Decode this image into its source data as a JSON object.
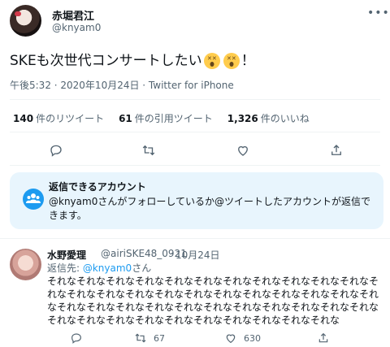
{
  "tweet": {
    "author_name": "赤堀君江",
    "author_handle": "@knyam0",
    "text": "SKEも次世代コンサートしたい",
    "text_suffix": "！",
    "emoji_icon": "astonished-face-icon",
    "meta": "午後5:32 · 2020年10月24日 · Twitter for iPhone",
    "more_icon": "more-icon",
    "stats": {
      "retweets_count": "140",
      "retweets_label": "件のリツイート",
      "quotes_count": "61",
      "quotes_label": "件の引用ツイート",
      "likes_count": "1,326",
      "likes_label": "件のいいね"
    }
  },
  "notice": {
    "title": "返信できるアカウント",
    "body": "@knyam0さんがフォローしているか@ツイートしたアカウントが返信できます。",
    "icon": "people-icon",
    "accent": "#1d9bf0"
  },
  "reply": {
    "author_name": "水野愛理",
    "author_handle": "@airiSKE48_0921",
    "dot": "·",
    "date": "10月24日",
    "replying_prefix": "返信先: ",
    "replying_handle": "@knyam0",
    "replying_suffix": "さん",
    "text": "それなそれなそれなそれなそれなそれなそれなそれなそれなそれなそれなそれなそれなそれなそれなそれなそれなそれなそれなそれなそれなそれなそれなそれなそれなそれなそれなそれなそれなそれなそれなそれなそれなそれなそれなそれなそれなそれなそれなそれなそれなそれなそれなそれな",
    "retweet_count": "67",
    "like_count": "630"
  }
}
